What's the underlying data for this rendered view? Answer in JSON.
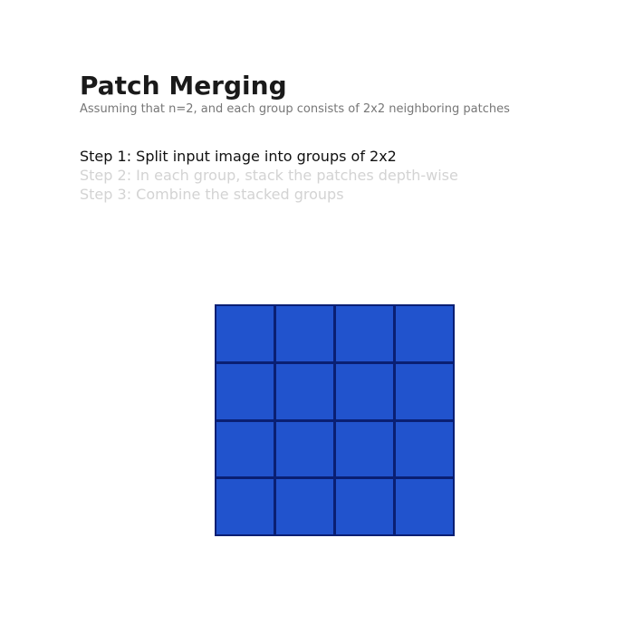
{
  "slide": {
    "title": "Patch Merging",
    "subtitle": "Assuming that n=2, and each group consists of 2x2 neighboring patches",
    "steps": [
      {
        "label": "Step 1: Split input image into groups of 2x2",
        "active": true
      },
      {
        "label": "Step 2: In each group, stack the patches depth-wise",
        "active": false
      },
      {
        "label": "Step 3: Combine the stacked groups",
        "active": false
      }
    ]
  },
  "diagram": {
    "grid_rows": 4,
    "grid_cols": 4,
    "patch_color": "#2153cd",
    "border_color": "#0a1f73",
    "active_text_color": "#111111",
    "inactive_text_color": "#d3d3d3"
  }
}
